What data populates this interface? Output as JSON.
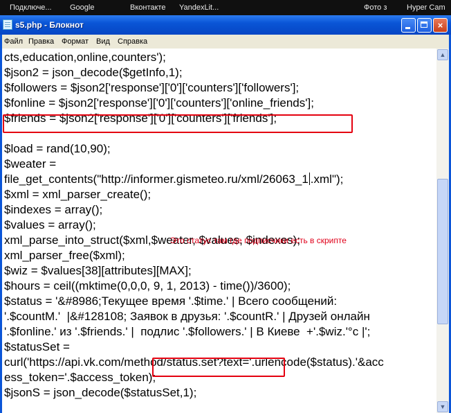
{
  "taskbar": {
    "items": [
      {
        "label": "Подключе..."
      },
      {
        "label": "Google"
      },
      {
        "label": "Вконтакте"
      },
      {
        "label": "YandexLit..."
      },
      {
        "label": "Фото з"
      },
      {
        "label": "Hyper Cam"
      }
    ]
  },
  "window": {
    "title": "s5.php - Блокнот",
    "buttons": {
      "minimize": "minimize-icon",
      "maximize": "maximize-icon",
      "close": "×"
    }
  },
  "menu": {
    "items": [
      {
        "label": "Файл"
      },
      {
        "label": "Правка"
      },
      {
        "label": "Формат"
      },
      {
        "label": "Вид"
      },
      {
        "label": "Справка"
      }
    ]
  },
  "editor": {
    "lines": [
      "cts,education,online,counters');",
      "$json2 = json_decode($getInfo,1);",
      "$followers = $json2['response']['0']['counters']['followers'];",
      "$fonline = $json2['response']['0']['counters']['online_friends'];",
      "$friends = $json2['response']['0']['counters']['friends'];",
      "",
      "$load = rand(10,90);",
      "$weater =",
      "file_get_contents(\"http://informer.gismeteo.ru/xml/26063_1",
      "$xml = xml_parser_create();",
      "$indexes = array();",
      "$values = array();",
      "xml_parse_into_struct($xml,$weater, $values, $indexes);",
      "xml_parser_free($xml);",
      "$wiz = $values[38][attributes][MAX];",
      "$hours = ceil((mktime(0,0,0, 9, 1, 2013) - time())/3600);",
      "$status = '&#8986;Текущее время '.$time.' | Всего сообщений:",
      "'.$countM.'  |&#128108; Заявок в друзья: '.$countR.' | Друзей онлайн",
      "'.$fonline.' из '.$friends.' |  подлис '.$followers.' | В Киеве  +'.$wiz.'°c |';",
      "$statusSet =",
      "curl('https://api.vk.com/method/status.set?text='.urlencode($status).'&acc",
      "ess_token='.$access_token);",
      "$jsonS = json_decode($statusSet,1);"
    ],
    "line8_after_caret": ".xml\");",
    "annotation": "Это статус там где подписчики есть в скрипте"
  },
  "colors": {
    "highlight": "#e4000f",
    "annotation": "#e0001a",
    "titlebar": "#0a55d6"
  }
}
